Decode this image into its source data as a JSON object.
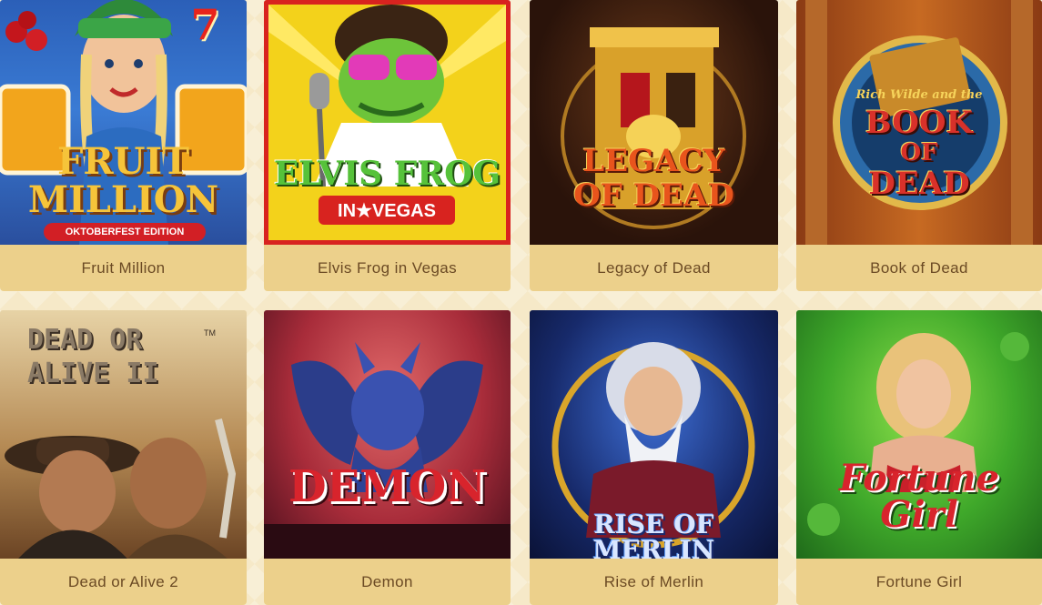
{
  "games": [
    {
      "name": "Fruit Million",
      "art_title_1": "FRUIT",
      "art_title_2": "MILLION",
      "art_subtitle": "OKTOBERFEST EDITION",
      "art_badge": "7"
    },
    {
      "name": "Elvis Frog in Vegas",
      "art_title_1": "ELVIS FROG",
      "art_subtitle": "IN★VEGAS"
    },
    {
      "name": "Legacy of Dead",
      "art_title_1": "LEGACY",
      "art_title_2": "OF DEAD"
    },
    {
      "name": "Book of Dead",
      "art_small": "Rich Wilde and the",
      "art_title_1": "BOOK",
      "art_title_2": "OF",
      "art_title_3": "DEAD"
    },
    {
      "name": "Dead or Alive 2",
      "art_title_1": "DEAD OR",
      "art_title_2": "ALIVE II",
      "art_badge": "TM"
    },
    {
      "name": "Demon",
      "art_title_1": "DEMON"
    },
    {
      "name": "Rise of Merlin",
      "art_title_1": "RISE OF MERLIN"
    },
    {
      "name": "Fortune Girl",
      "art_title_1": "Fortune Girl"
    }
  ]
}
